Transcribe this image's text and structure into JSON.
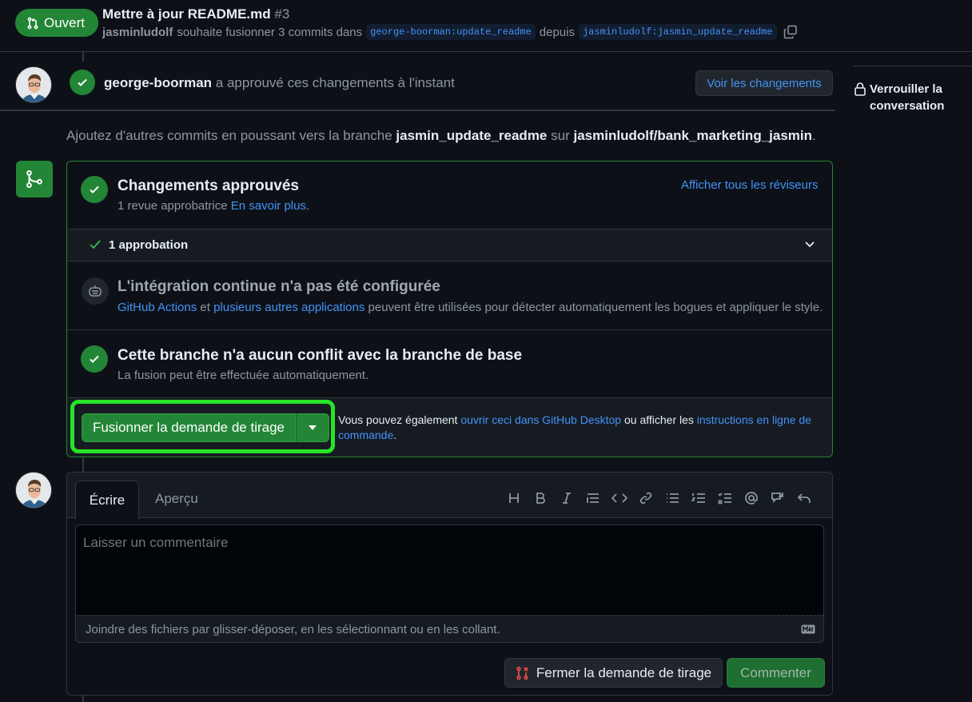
{
  "header": {
    "state_label": "Ouvert",
    "title": "Mettre à jour README.md",
    "number": "#3",
    "author": "jasminludolf",
    "meta_text": "souhaite fusionner 3 commits dans",
    "base_branch": "george-boorman:update_readme",
    "from_text": "depuis",
    "head_branch": "jasminludolf:jasmin_update_readme"
  },
  "review": {
    "reviewer": "george-boorman",
    "text": "a approuvé ces changements à l'instant",
    "view_changes_label": "Voir les changements"
  },
  "sidebar": {
    "lock_line1": "Verrouiller la",
    "lock_line2": "conversation"
  },
  "hint": {
    "prefix": "Ajoutez d'autres commits en poussant vers la branche",
    "branch": "jasmin_update_readme",
    "middle": "sur",
    "repo": "jasminludolf/bank_marketing_jasmin",
    "suffix": "."
  },
  "merge_box": {
    "approved_title": "Changements approuvés",
    "approved_sub": "1 revue approbatrice",
    "learn_more": "En savoir plus",
    "learn_more_suffix": ".",
    "show_reviewers": "Afficher tous les réviseurs",
    "approvals_count": "1 approbation",
    "ci_title": "L'intégration continue n'a pas été configurée",
    "ci_link1": "GitHub Actions",
    "ci_and": "et",
    "ci_link2": "plusieurs autres applications",
    "ci_rest": "peuvent être utilisées pour détecter automatiquement les bogues et appliquer le style.",
    "conflict_title": "Cette branche n'a aucun conflit avec la branche de base",
    "conflict_sub": "La fusion peut être effectuée automatiquement.",
    "merge_button": "Fusionner la demande de tirage",
    "alt_prefix": "Vous pouvez également",
    "alt_link1": "ouvrir ceci dans GitHub Desktop",
    "alt_middle": "ou afficher les",
    "alt_link2": "instructions en ligne de commande",
    "alt_suffix": ".",
    "highlight_color": "#27e327"
  },
  "comment": {
    "tab_write": "Écrire",
    "tab_preview": "Aperçu",
    "placeholder": "Laisser un commentaire",
    "attach_text": "Joindre des fichiers par glisser-déposer, en les sélectionnant ou en les collant.",
    "close_button": "Fermer la demande de tirage",
    "comment_button": "Commenter",
    "toolbar_icons": [
      "heading-icon",
      "bold-icon",
      "italic-icon",
      "quote-icon",
      "code-icon",
      "link-icon",
      "unordered-list-icon",
      "ordered-list-icon",
      "task-list-icon",
      "mention-icon",
      "reference-icon",
      "undo-icon"
    ]
  },
  "colors": {
    "accent_green": "#238636",
    "link_blue": "#4493f8",
    "background": "#0d1117"
  }
}
